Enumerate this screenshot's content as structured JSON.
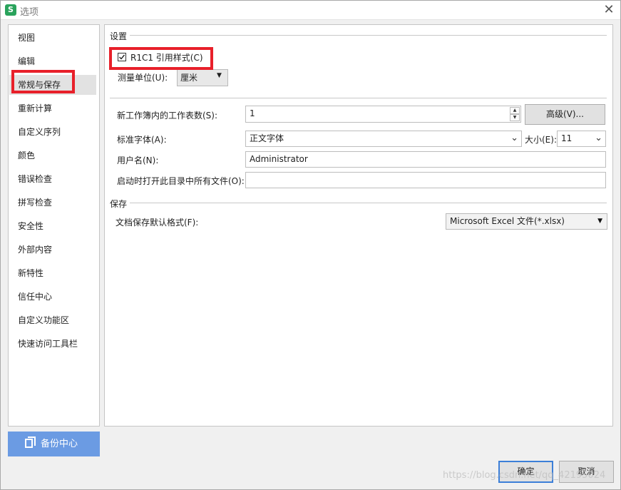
{
  "window": {
    "title": "选项",
    "app_icon": "S",
    "close": "✕"
  },
  "nav": {
    "items": [
      {
        "label": "视图"
      },
      {
        "label": "编辑"
      },
      {
        "label": "常规与保存"
      },
      {
        "label": "重新计算"
      },
      {
        "label": "自定义序列"
      },
      {
        "label": "颜色"
      },
      {
        "label": "错误检查"
      },
      {
        "label": "拼写检查"
      },
      {
        "label": "安全性"
      },
      {
        "label": "外部内容"
      },
      {
        "label": "新特性"
      },
      {
        "label": "信任中心"
      },
      {
        "label": "自定义功能区"
      },
      {
        "label": "快速访问工具栏"
      }
    ],
    "selected": "常规与保存",
    "backup_label": "备份中心"
  },
  "settings": {
    "section_title": "设置",
    "r1c1_label": "R1C1 引用样式(C)",
    "r1c1_checked": true,
    "unit_label": "测量单位(U):",
    "unit_value": "厘米",
    "sheets_label": "新工作簿内的工作表数(S):",
    "sheets_value": "1",
    "advanced_button": "高级(V)...",
    "font_label": "标准字体(A):",
    "font_value": "正文字体",
    "size_label": "大小(E):",
    "size_value": "11",
    "username_label": "用户名(N):",
    "username_value": "Administrator",
    "startup_label": "启动时打开此目录中所有文件(O):",
    "startup_value": ""
  },
  "save": {
    "section_title": "保存",
    "format_label": "文档保存默认格式(F):",
    "format_value": "Microsoft Excel 文件(*.xlsx)"
  },
  "footer": {
    "ok": "确定",
    "cancel": "取消",
    "watermark": "https://blog.csdn.net/qq_42195024"
  },
  "colors": {
    "highlight_red": "#e8202a",
    "backup_blue": "#6b9be3",
    "ok_border": "#3c7fd8"
  }
}
